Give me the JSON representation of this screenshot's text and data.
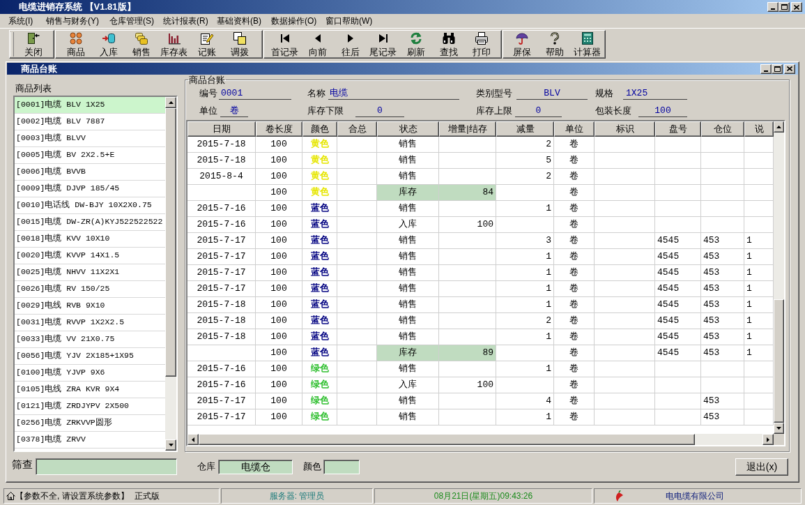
{
  "window": {
    "title": "电缆进销存系统 【V1.81版】"
  },
  "menu": [
    "系统(I)",
    "销售与财务(Y)",
    "仓库管理(S)",
    "统计报表(R)",
    "基础资料(B)",
    "数据操作(O)",
    "窗口帮助(W)"
  ],
  "toolbar": [
    [
      "关闭"
    ],
    [
      "商品",
      "入库",
      "销售",
      "库存表",
      "记账",
      "调拨"
    ],
    [
      "首记录",
      "向前",
      "往后",
      "尾记录",
      "刷新",
      "查找",
      "打印"
    ],
    [
      "屏保",
      "帮助",
      "计算器"
    ]
  ],
  "child_window": {
    "title": "商品台账"
  },
  "product_list": {
    "label": "商品列表",
    "items": [
      {
        "text": "[0001]电缆 BLV 1X25",
        "selected": true
      },
      {
        "text": "[0002]电缆 BLV 7887",
        "selected": false
      },
      {
        "text": "[0003]电缆 BLVV",
        "selected": false
      },
      {
        "text": "[0005]电缆 BV 2X2.5+E",
        "selected": false
      },
      {
        "text": "[0006]电缆 BVVB",
        "selected": false
      },
      {
        "text": "[0009]电缆 DJVP 185/45",
        "selected": false
      },
      {
        "text": "[0010]电话线 DW-BJY 10X2X0.75",
        "selected": false
      },
      {
        "text": "[0015]电缆 DW-ZR(A)KYJ522522522",
        "selected": false
      },
      {
        "text": "[0018]电缆 KVV 10X10",
        "selected": false
      },
      {
        "text": "[0020]电缆 KVVP 14X1.5",
        "selected": false
      },
      {
        "text": "[0025]电缆 NHVV 11X2X1",
        "selected": false
      },
      {
        "text": "[0026]电缆 RV 150/25",
        "selected": false
      },
      {
        "text": "[0029]电线 RVB 9X10",
        "selected": false
      },
      {
        "text": "[0031]电缆 RVVP 1X2X2.5",
        "selected": false
      },
      {
        "text": "[0033]电缆 VV 21X0.75",
        "selected": false
      },
      {
        "text": "[0056]电缆 YJV 2X185+1X95",
        "selected": false
      },
      {
        "text": "[0100]电缆 YJVP 9X6",
        "selected": false
      },
      {
        "text": "[0105]电线 ZRA KVR 9X4",
        "selected": false
      },
      {
        "text": "[0121]电缆 ZRDJYPV 2X500",
        "selected": false
      },
      {
        "text": "[0256]电缆 ZRKVVP圆形",
        "selected": false
      },
      {
        "text": "[0378]电缆 ZRVV",
        "selected": false
      }
    ]
  },
  "ledger": {
    "title": "商品台账",
    "fields": [
      [
        {
          "label": "编号",
          "value": "0001"
        },
        {
          "label": "名称",
          "value": "电缆"
        },
        {
          "label": "类别型号",
          "value": "BLV"
        },
        {
          "label": "规格",
          "value": "1X25"
        }
      ],
      [
        {
          "label": "单位",
          "value": "卷"
        },
        {
          "label": "库存下限",
          "value": "0"
        },
        {
          "label": "库存上限",
          "value": "0"
        },
        {
          "label": "包装长度",
          "value": "100"
        }
      ]
    ],
    "table": {
      "columns": [
        "日期",
        "卷长度",
        "颜色",
        "合总",
        "状态",
        "增量|结存",
        "减量",
        "单位",
        "标识",
        "盘号",
        "仓位",
        "说"
      ],
      "rows": [
        {
          "kind": "record",
          "date": "2015-7-18",
          "length": "100",
          "color_name": "黄色",
          "color": "#e6e600",
          "status": "销售",
          "decrease": "2",
          "unit": "卷"
        },
        {
          "kind": "record",
          "date": "2015-7-18",
          "length": "100",
          "color_name": "黄色",
          "color": "#e6e600",
          "status": "销售",
          "decrease": "5",
          "unit": "卷"
        },
        {
          "kind": "record",
          "date": "2015-8-4",
          "length": "100",
          "color_name": "黄色",
          "color": "#e6e600",
          "status": "销售",
          "decrease": "2",
          "unit": "卷"
        },
        {
          "kind": "balance",
          "length": "100",
          "color_name": "黄色",
          "color": "#e6e600",
          "status": "库存",
          "change": "84",
          "unit": "卷"
        },
        {
          "kind": "record",
          "date": "2015-7-16",
          "length": "100",
          "color_name": "蓝色",
          "color": "#000080",
          "status": "销售",
          "decrease": "1",
          "unit": "卷"
        },
        {
          "kind": "record",
          "date": "2015-7-16",
          "length": "100",
          "color_name": "蓝色",
          "color": "#000080",
          "status": "入库",
          "change": "100",
          "unit": "卷"
        },
        {
          "kind": "record",
          "date": "2015-7-17",
          "length": "100",
          "color_name": "蓝色",
          "color": "#000080",
          "status": "销售",
          "decrease": "3",
          "unit": "卷",
          "reel": "4545",
          "location": "453",
          "column_12": "1"
        },
        {
          "kind": "record",
          "date": "2015-7-17",
          "length": "100",
          "color_name": "蓝色",
          "color": "#000080",
          "status": "销售",
          "decrease": "1",
          "unit": "卷",
          "reel": "4545",
          "location": "453",
          "column_12": "1"
        },
        {
          "kind": "record",
          "date": "2015-7-17",
          "length": "100",
          "color_name": "蓝色",
          "color": "#000080",
          "status": "销售",
          "decrease": "1",
          "unit": "卷",
          "reel": "4545",
          "location": "453",
          "column_12": "1"
        },
        {
          "kind": "record",
          "date": "2015-7-17",
          "length": "100",
          "color_name": "蓝色",
          "color": "#000080",
          "status": "销售",
          "decrease": "1",
          "unit": "卷",
          "reel": "4545",
          "location": "453",
          "column_12": "1"
        },
        {
          "kind": "record",
          "date": "2015-7-18",
          "length": "100",
          "color_name": "蓝色",
          "color": "#000080",
          "status": "销售",
          "decrease": "1",
          "unit": "卷",
          "reel": "4545",
          "location": "453",
          "column_12": "1"
        },
        {
          "kind": "record",
          "date": "2015-7-18",
          "length": "100",
          "color_name": "蓝色",
          "color": "#000080",
          "status": "销售",
          "decrease": "2",
          "unit": "卷",
          "reel": "4545",
          "location": "453",
          "column_12": "1"
        },
        {
          "kind": "record",
          "date": "2015-7-18",
          "length": "100",
          "color_name": "蓝色",
          "color": "#000080",
          "status": "销售",
          "decrease": "1",
          "unit": "卷",
          "reel": "4545",
          "location": "453",
          "column_12": "1"
        },
        {
          "kind": "balance",
          "length": "100",
          "color_name": "蓝色",
          "color": "#000080",
          "status": "库存",
          "change": "89",
          "unit": "卷",
          "reel": "4545",
          "location": "453",
          "column_12": "1"
        },
        {
          "kind": "record",
          "date": "2015-7-16",
          "length": "100",
          "color_name": "绿色",
          "color": "#33c033",
          "status": "销售",
          "decrease": "1",
          "unit": "卷"
        },
        {
          "kind": "record",
          "date": "2015-7-16",
          "length": "100",
          "color_name": "绿色",
          "color": "#33c033",
          "status": "入库",
          "change": "100",
          "unit": "卷"
        },
        {
          "kind": "record",
          "date": "2015-7-17",
          "length": "100",
          "color_name": "绿色",
          "color": "#33c033",
          "status": "销售",
          "decrease": "4",
          "unit": "卷",
          "location": "453"
        },
        {
          "kind": "record",
          "date": "2015-7-17",
          "length": "100",
          "color_name": "绿色",
          "color": "#33c033",
          "status": "销售",
          "decrease": "1",
          "unit": "卷",
          "location": "453"
        }
      ]
    }
  },
  "filter": {
    "label": "筛查"
  },
  "warehouse": {
    "label": "仓库",
    "value": "电缆仓"
  },
  "color_filter": {
    "label": "颜色"
  },
  "exit_button": "退出(x)",
  "status_bar": {
    "message": "【参数不全, 请设置系统参数】",
    "edition": "正式版",
    "server": "服务器: 管理员",
    "datetime": "08月21日(星期五)09:43:26",
    "company": "电电缆有限公司"
  }
}
